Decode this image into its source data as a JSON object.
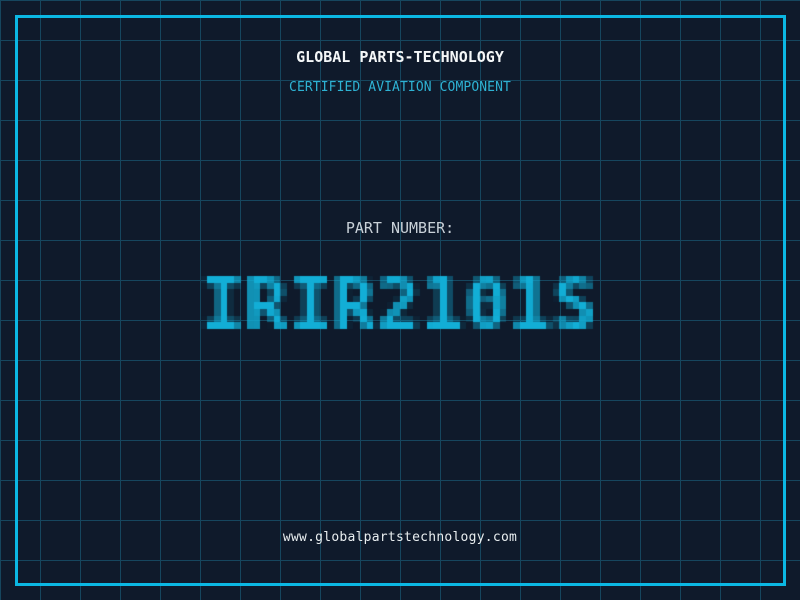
{
  "colors": {
    "background": "#0f1a2b",
    "grid_line": "#16465e",
    "frame_cyan": "#0bb7e3",
    "part_number_cyan": "#12aed6",
    "tagline_cyan": "#2eb2d3",
    "title_white": "#f4f7f8",
    "label_gray": "#c9d1d8",
    "url_white": "#e9eef0"
  },
  "header": {
    "company": "GLOBAL PARTS-TECHNOLOGY",
    "tagline": "CERTIFIED AVIATION COMPONENT"
  },
  "part": {
    "label": "PART NUMBER:",
    "number": "IRIR2101S"
  },
  "footer": {
    "website": "www.globalpartstechnology.com"
  }
}
